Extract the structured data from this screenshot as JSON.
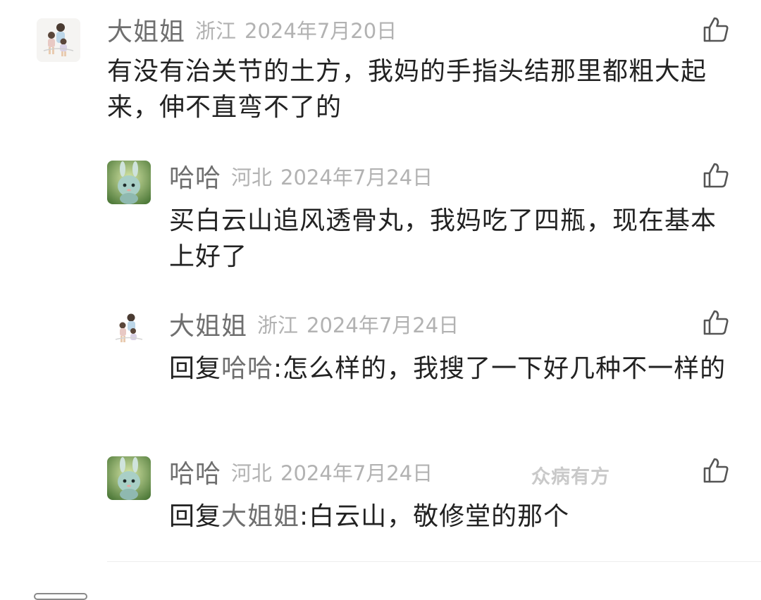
{
  "comments": [
    {
      "username": "大姐姐",
      "region": "浙江",
      "date": "2024年7月20日",
      "text": "有没有治关节的土方，我妈的手指头结那里都粗大起来，伸不直弯不了的",
      "avatar_icon": "family-photo-avatar"
    },
    {
      "username": "哈哈",
      "region": "河北",
      "date": "2024年7月24日",
      "text": "买白云山追风透骨丸，我妈吃了四瓶，现在基本上好了",
      "avatar_icon": "green-bunny-avatar"
    },
    {
      "username": "大姐姐",
      "region": "浙江",
      "date": "2024年7月24日",
      "reply_prefix": "回复",
      "reply_to": "哈哈",
      "text": ":怎么样的，我搜了一下好几种不一样的",
      "avatar_icon": "family-photo-avatar"
    },
    {
      "username": "哈哈",
      "region": "河北",
      "date": "2024年7月24日",
      "reply_prefix": "回复",
      "reply_to": "大姐姐",
      "text": ":白云山，敬修堂的那个",
      "avatar_icon": "green-bunny-avatar"
    }
  ],
  "watermark": "众病有方",
  "like_icon": "thumbs-up-icon",
  "colors": {
    "username": "#6f6f6f",
    "meta": "#b2b2b2",
    "text": "#222222",
    "divider": "#eeeeee"
  }
}
